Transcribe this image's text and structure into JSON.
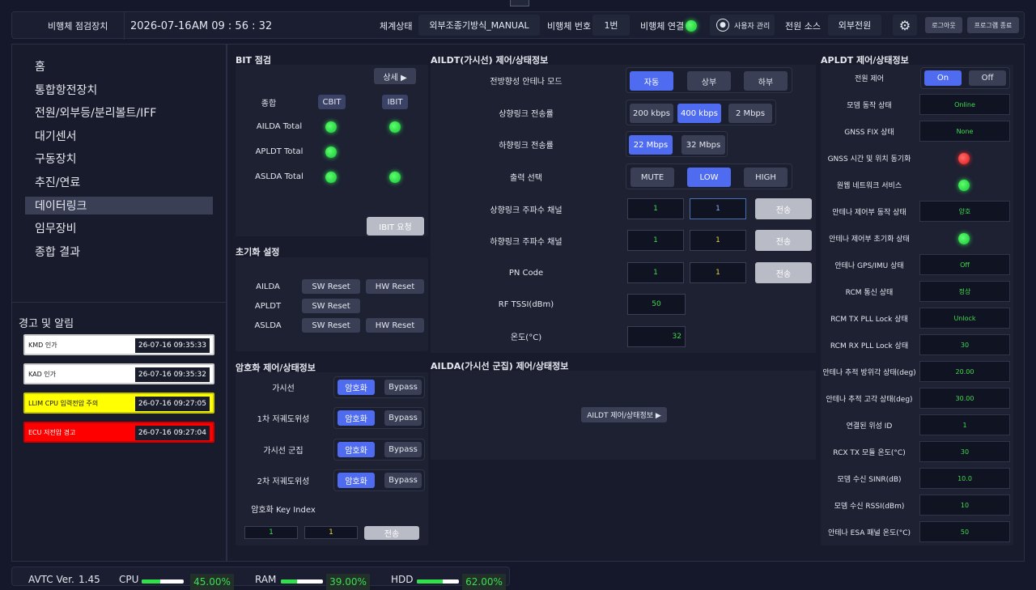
{
  "header": {
    "app_title": "비행체 점검장치",
    "date": "2026-07-16",
    "time": "AM 09 : 56 : 32",
    "system_state_label": "체계상태",
    "system_state_value": "외부조종기방식_MANUAL",
    "vehicle_no_label": "비행체 번호",
    "vehicle_no_value": "1번",
    "vehicle_link_label": "비행체 연결",
    "user_admin_label": "사용자 관리",
    "power_source_label": "전원 소스",
    "power_source_value": "외부전원",
    "logout_label": "로그아웃",
    "exit_label": "프로그램 종료"
  },
  "sidebar": {
    "items": [
      {
        "label": "홈"
      },
      {
        "label": "통합항전장치"
      },
      {
        "label": "전원/외부등/분리볼트/IFF"
      },
      {
        "label": "대기센서"
      },
      {
        "label": "구동장치"
      },
      {
        "label": "추진/연료"
      },
      {
        "label": "데이터링크",
        "active": true
      },
      {
        "label": "임무장비"
      },
      {
        "label": "종합 결과"
      }
    ],
    "alerts_title": "경고 및 알림",
    "alerts": [
      {
        "text": "KMD 인가",
        "time": "26-07-16 09:35:33",
        "bg": "#ffffff",
        "fg": "#111111"
      },
      {
        "text": "KAD 인가",
        "time": "26-07-16 09:35:32",
        "bg": "#ffffff",
        "fg": "#111111"
      },
      {
        "text": "LLIM CPU 입력전압 주의",
        "time": "26-07-16 09:27:05",
        "bg": "#ffff00",
        "fg": "#111111"
      },
      {
        "text": "ECU 저전압 경고",
        "time": "26-07-16 09:27:04",
        "bg": "#ff0000",
        "fg": "#ffffff"
      }
    ]
  },
  "bit": {
    "title": "BIT 점검",
    "detail_label": "상세 ▶",
    "summary_label": "종합",
    "cbit_label": "CBIT",
    "ibit_label": "IBIT",
    "rows": [
      {
        "label": "AILDA Total",
        "cbit": "green",
        "ibit": "green"
      },
      {
        "label": "APLDT Total",
        "cbit": "green",
        "ibit": null
      },
      {
        "label": "ASLDA Total",
        "cbit": "green",
        "ibit": "green"
      }
    ],
    "ibit_request_label": "IBIT 요청"
  },
  "init": {
    "title": "초기화 설정",
    "rows": [
      {
        "label": "AILDA",
        "sw": "SW Reset",
        "hw": "HW Reset"
      },
      {
        "label": "APLDT",
        "sw": "SW Reset",
        "hw": null
      },
      {
        "label": "ASLDA",
        "sw": "SW Reset",
        "hw": "HW Reset"
      }
    ]
  },
  "crypto": {
    "title": "암호화 제어/상태정보",
    "rows": [
      {
        "label": "가시선",
        "enc": "암호화",
        "bypass": "Bypass"
      },
      {
        "label": "1차 저궤도위성",
        "enc": "암호화",
        "bypass": "Bypass"
      },
      {
        "label": "가시선 군집",
        "enc": "암호화",
        "bypass": "Bypass"
      },
      {
        "label": "2차 저궤도위성",
        "enc": "암호화",
        "bypass": "Bypass"
      }
    ],
    "key_index_label": "암호화 Key Index",
    "key_value_1": "1",
    "key_value_2": "1",
    "send_label": "전송"
  },
  "aildt": {
    "title": "AILDT(가시선) 제어/상태정보",
    "antenna_mode_label": "전방향성 안테나 모드",
    "antenna_modes": [
      "자동",
      "상부",
      "하부"
    ],
    "uplink_rate_label": "상향링크 전송률",
    "uplink_rates": [
      "200 kbps",
      "400 kbps",
      "2 Mbps"
    ],
    "downlink_rate_label": "하향링크 전송률",
    "downlink_rates": [
      "22 Mbps",
      "32 Mbps"
    ],
    "output_label": "출력 선택",
    "outputs": [
      "MUTE",
      "LOW",
      "HIGH"
    ],
    "uplink_channel_label": "상향링크 주파수 채널",
    "uplink_channel_cur": "1",
    "uplink_channel_set": "1",
    "downlink_channel_label": "하향링크 주파수 채널",
    "downlink_channel_cur": "1",
    "downlink_channel_set": "1",
    "pn_code_label": "PN Code",
    "pn_code_cur": "1",
    "pn_code_set": "1",
    "send_label": "전송",
    "rf_tssi_label": "RF TSSI(dBm)",
    "rf_tssi_value": "50",
    "temp_label": "온도(°C)",
    "temp_value": "32"
  },
  "ailda": {
    "title": "AILDA(가시선 군집) 제어/상태정보",
    "button_label": "AILDT 제어/상태정보 ▶"
  },
  "apldt": {
    "title": "APLDT 제어/상태정보",
    "power_label": "전원 제어",
    "on_label": "On",
    "off_label": "Off",
    "rows": [
      {
        "label": "모뎀 동작 상태",
        "value": "Online"
      },
      {
        "label": "GNSS FIX 상태",
        "value": "None"
      },
      {
        "label": "GNSS 시간 및 위치 동기화",
        "led": "red"
      },
      {
        "label": "원웹 네트워크 서비스",
        "led": "green"
      },
      {
        "label": "안테나 제어부 동작 상태",
        "value": "양호"
      },
      {
        "label": "안테나 제어부 초기화 상태",
        "led": "green"
      },
      {
        "label": "안테나 GPS/IMU 상태",
        "value": "Off"
      },
      {
        "label": "RCM 통신 상태",
        "value": "정상"
      },
      {
        "label": "RCM TX PLL Lock 상태",
        "value": "Unlock"
      },
      {
        "label": "RCM RX PLL Lock 상태",
        "value": "30"
      },
      {
        "label": "안테나 추적 방위각 상태(deg)",
        "value": "20.00"
      },
      {
        "label": "안테나 추적 고각 상태(deg)",
        "value": "30.00"
      },
      {
        "label": "연결된 위성 ID",
        "value": "1"
      },
      {
        "label": "RCX TX 모듈 온도(°C)",
        "value": "30"
      },
      {
        "label": "모뎀 수신 SINR(dB)",
        "value": "10.0"
      },
      {
        "label": "모뎀 수신 RSSI(dBm)",
        "value": "10"
      },
      {
        "label": "안테나 ESA 패널 온도(°C)",
        "value": "50"
      }
    ]
  },
  "status": {
    "version_label": "AVTC Ver.",
    "version_value": "1.45",
    "cpu_label": "CPU",
    "cpu_value": "45.00%",
    "cpu_fraction": 0.45,
    "ram_label": "RAM",
    "ram_value": "39.00%",
    "ram_fraction": 0.39,
    "hdd_label": "HDD",
    "hdd_value": "62.00%",
    "hdd_fraction": 0.62
  },
  "colors": {
    "accent": "#4f6cf0",
    "ok": "#2fe24a",
    "error": "#e01818"
  }
}
